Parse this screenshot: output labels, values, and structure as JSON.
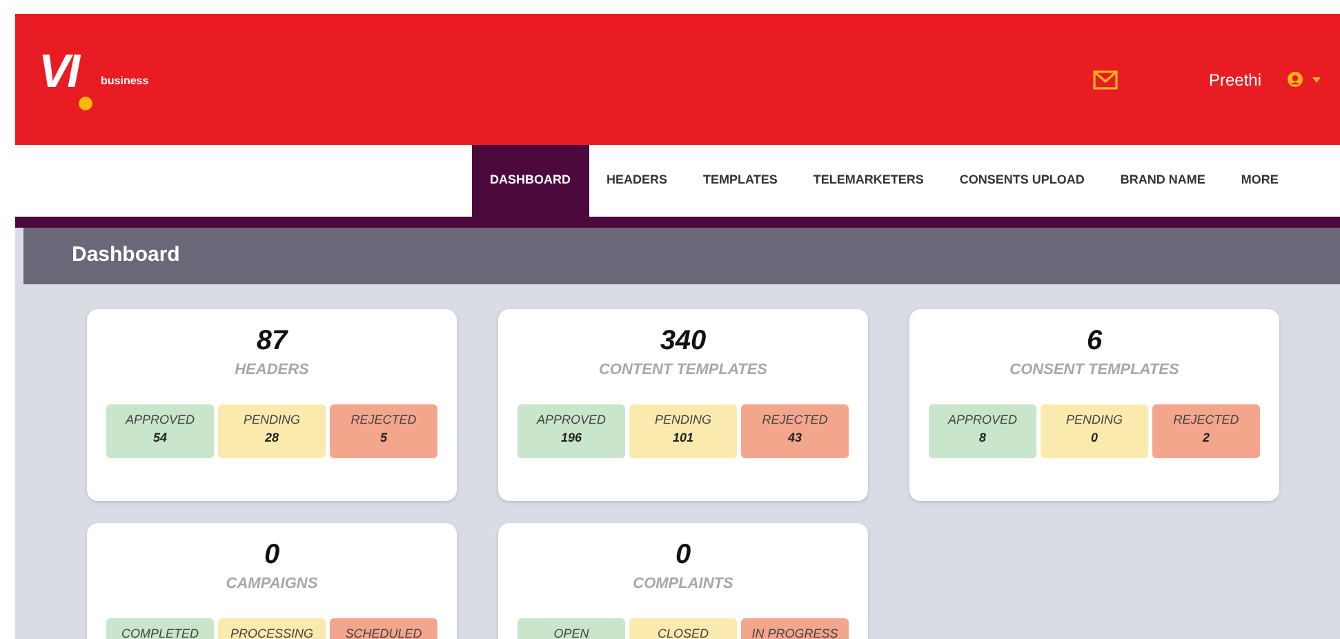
{
  "brand": {
    "logo": "VI",
    "tagline": "business"
  },
  "user": {
    "name": "Preethi"
  },
  "nav": [
    {
      "label": "DASHBOARD",
      "selected": true
    },
    {
      "label": "HEADERS",
      "selected": false
    },
    {
      "label": "TEMPLATES",
      "selected": false
    },
    {
      "label": "TELEMARKETERS",
      "selected": false
    },
    {
      "label": "CONSENTS UPLOAD",
      "selected": false
    },
    {
      "label": "BRAND NAME",
      "selected": false
    },
    {
      "label": "MORE",
      "selected": false
    }
  ],
  "page_title": "Dashboard",
  "cards": [
    {
      "count": "87",
      "title": "HEADERS",
      "stats": [
        {
          "label": "APPROVED",
          "value": "54",
          "color": "#c9e5cb"
        },
        {
          "label": "PENDING",
          "value": "28",
          "color": "#fbeaae"
        },
        {
          "label": "REJECTED",
          "value": "5",
          "color": "#f3a68c"
        }
      ]
    },
    {
      "count": "340",
      "title": "CONTENT TEMPLATES",
      "stats": [
        {
          "label": "APPROVED",
          "value": "196",
          "color": "#c9e5cb"
        },
        {
          "label": "PENDING",
          "value": "101",
          "color": "#fbeaae"
        },
        {
          "label": "REJECTED",
          "value": "43",
          "color": "#f3a68c"
        }
      ]
    },
    {
      "count": "6",
      "title": "CONSENT TEMPLATES",
      "stats": [
        {
          "label": "APPROVED",
          "value": "8",
          "color": "#c9e5cb"
        },
        {
          "label": "PENDING",
          "value": "0",
          "color": "#fbeaae"
        },
        {
          "label": "REJECTED",
          "value": "2",
          "color": "#f3a68c"
        }
      ]
    },
    {
      "count": "0",
      "title": "CAMPAIGNS",
      "stats": [
        {
          "label": "COMPLETED",
          "color": "#c9e5cb"
        },
        {
          "label": "PROCESSING",
          "color": "#fbeaae"
        },
        {
          "label": "SCHEDULED",
          "color": "#f3a68c"
        }
      ]
    },
    {
      "count": "0",
      "title": "COMPLAINTS",
      "stats": [
        {
          "label": "OPEN",
          "color": "#c9e5cb"
        },
        {
          "label": "CLOSED",
          "color": "#fbeaae"
        },
        {
          "label": "IN PROGRESS",
          "color": "#f3a68c"
        }
      ]
    }
  ]
}
